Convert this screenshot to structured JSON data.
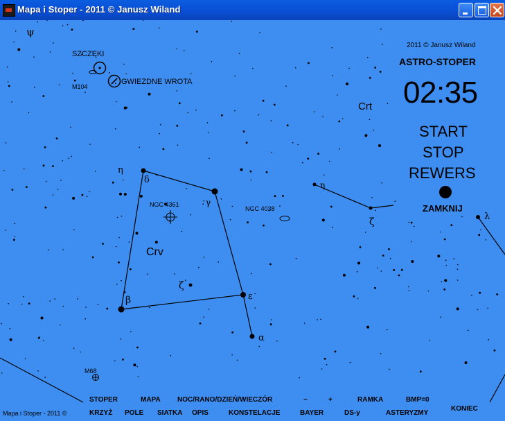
{
  "window": {
    "title": "Mapa i Stoper - 2011 © Janusz Wiland",
    "icons": [
      "app-icon",
      "minimize-icon",
      "maximize-icon",
      "close-icon"
    ]
  },
  "stopwatch": {
    "copyright": "2011 © Janusz Wiland",
    "title": "ASTRO-STOPER",
    "time": "02:35",
    "start": "START",
    "stop": "STOP",
    "reverse": "REWERS",
    "close": "ZAMKNIJ"
  },
  "map": {
    "labels": {
      "psi": "ψ",
      "jaws": "SZCZĘKI",
      "m104": "M104",
      "stargate": "GWIEZDNE WROTA",
      "crt": "Crt",
      "eta_crv": "η",
      "delta": "δ",
      "gamma": "γ",
      "ngc4361": "NGC 4361",
      "ngc4038": "NGC 4038",
      "crv": "Crv",
      "zeta_crv": "ζ",
      "beta": "β",
      "epsilon": "ε",
      "alpha": "α",
      "eta_crt": "η",
      "zeta_crt": "ζ",
      "lambda": "λ",
      "m68": "M68"
    }
  },
  "menu": {
    "row1": [
      "STOPER",
      "MAPA",
      "NOC/RANO/DZIEŃ/WIECZÓR",
      "−",
      "+",
      "RAMKA",
      "BMP=0"
    ],
    "row2": [
      "KRZYŻ",
      "POLE",
      "SIATKA",
      "OPIS",
      "KONSTELACJE",
      "BAYER",
      "DS-y",
      "ASTERYZMY"
    ],
    "exit": "KONIEC"
  },
  "footer": {
    "credit": "Mapa i Stoper - 2011 ©"
  }
}
